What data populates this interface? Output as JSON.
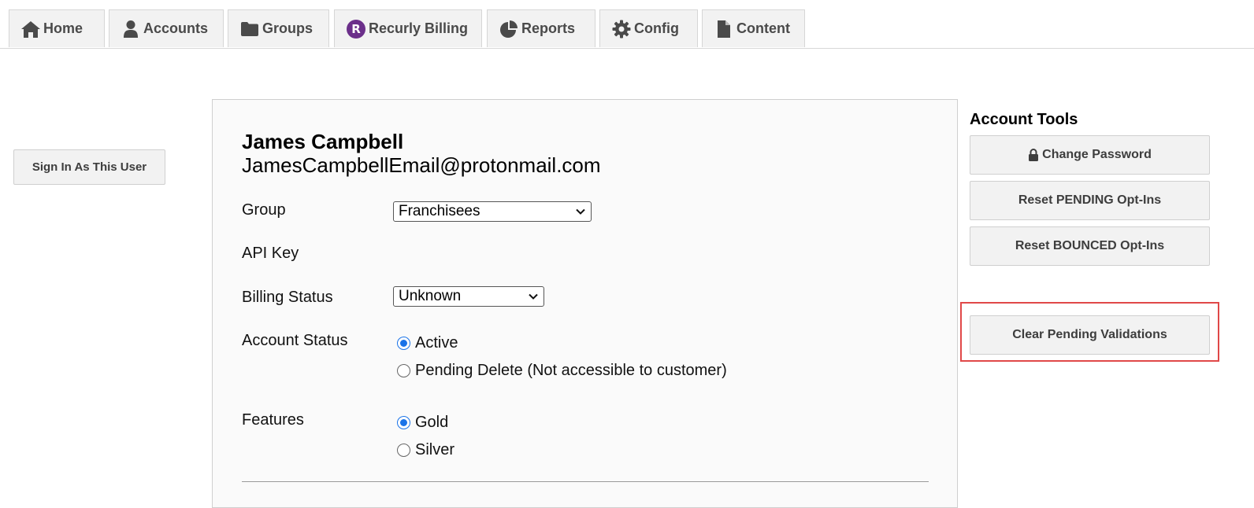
{
  "nav": {
    "tabs": [
      {
        "label": "Home",
        "icon": "home-icon"
      },
      {
        "label": "Accounts",
        "icon": "user-icon"
      },
      {
        "label": "Groups",
        "icon": "folder-icon"
      },
      {
        "label": "Recurly Billing",
        "icon": "recurly-icon",
        "icon_letter": "R"
      },
      {
        "label": "Reports",
        "icon": "pie-chart-icon"
      },
      {
        "label": "Config",
        "icon": "gear-icon"
      },
      {
        "label": "Content",
        "icon": "file-icon"
      }
    ]
  },
  "sidebar": {
    "sign_in_label": "Sign In As This User"
  },
  "account": {
    "name": "James Campbell",
    "email": "JamesCampbellEmail@protonmail.com",
    "group_label": "Group",
    "group_value": "Franchisees",
    "api_key_label": "API Key",
    "billing_status_label": "Billing Status",
    "billing_status_value": "Unknown",
    "account_status_label": "Account Status",
    "account_status_options": [
      {
        "label": "Active",
        "checked": true
      },
      {
        "label": "Pending Delete (Not accessible to customer)",
        "checked": false
      }
    ],
    "features_label": "Features",
    "features_options": [
      {
        "label": "Gold",
        "checked": true
      },
      {
        "label": "Silver",
        "checked": false
      }
    ]
  },
  "tools": {
    "title": "Account Tools",
    "change_password": "Change Password",
    "reset_pending": "Reset PENDING Opt-Ins",
    "reset_bounced": "Reset BOUNCED Opt-Ins",
    "clear_pending": "Clear Pending Validations"
  },
  "colors": {
    "recurly_brand": "#6b2f8a",
    "radio_accent": "#1a73e8",
    "highlight": "#e04848"
  }
}
